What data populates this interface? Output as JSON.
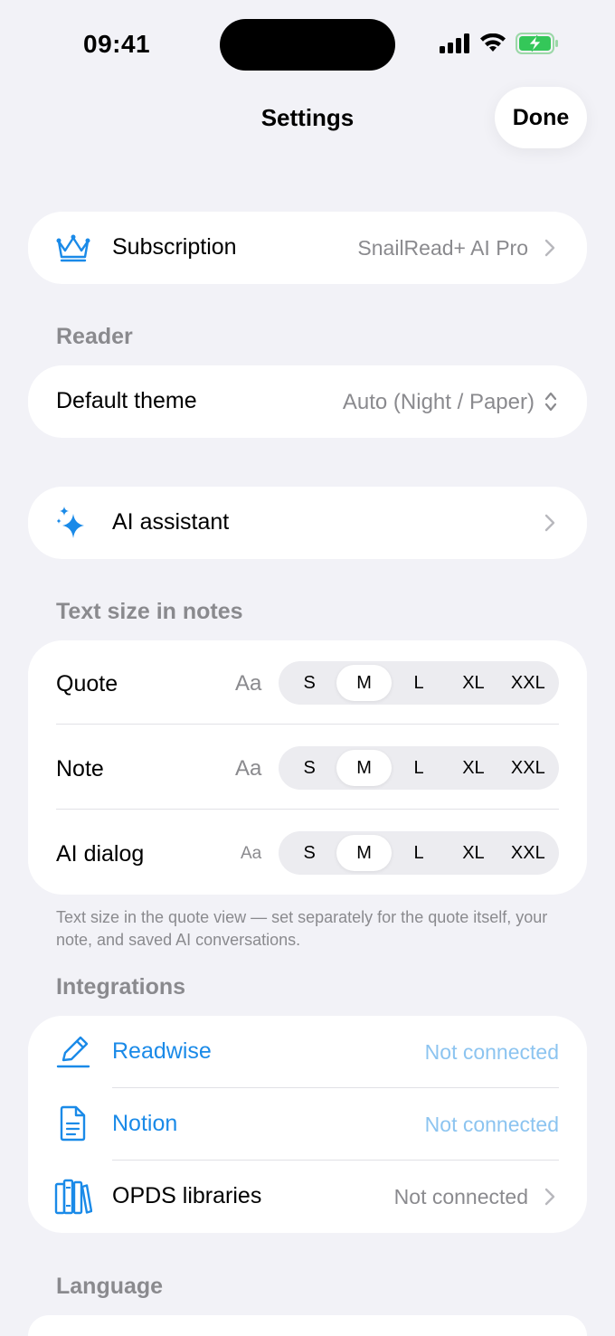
{
  "status_bar": {
    "time": "09:41"
  },
  "nav": {
    "title": "Settings",
    "done_label": "Done"
  },
  "subscription": {
    "label": "Subscription",
    "value": "SnailRead+ AI Pro"
  },
  "reader": {
    "header": "Reader",
    "default_theme_label": "Default theme",
    "default_theme_value": "Auto (Night / Paper)"
  },
  "ai_assistant": {
    "label": "AI assistant"
  },
  "text_size": {
    "header": "Text size in notes",
    "aa_label": "Aa",
    "options": [
      "S",
      "M",
      "L",
      "XL",
      "XXL"
    ],
    "rows": [
      {
        "label": "Quote",
        "selected": "M"
      },
      {
        "label": "Note",
        "selected": "M"
      },
      {
        "label": "AI dialog",
        "selected": "M"
      }
    ],
    "footer": "Text size in the quote view — set separately for the quote itself, your note, and saved AI conversations."
  },
  "integrations": {
    "header": "Integrations",
    "items": [
      {
        "label": "Readwise",
        "status": "Not connected"
      },
      {
        "label": "Notion",
        "status": "Not connected"
      },
      {
        "label": "OPDS libraries",
        "status": "Not connected"
      }
    ]
  },
  "language": {
    "header": "Language"
  },
  "colors": {
    "accent": "#1A8AE8",
    "background": "#F2F2F7",
    "secondary_text": "#8A8A8E",
    "battery": "#34C759"
  }
}
